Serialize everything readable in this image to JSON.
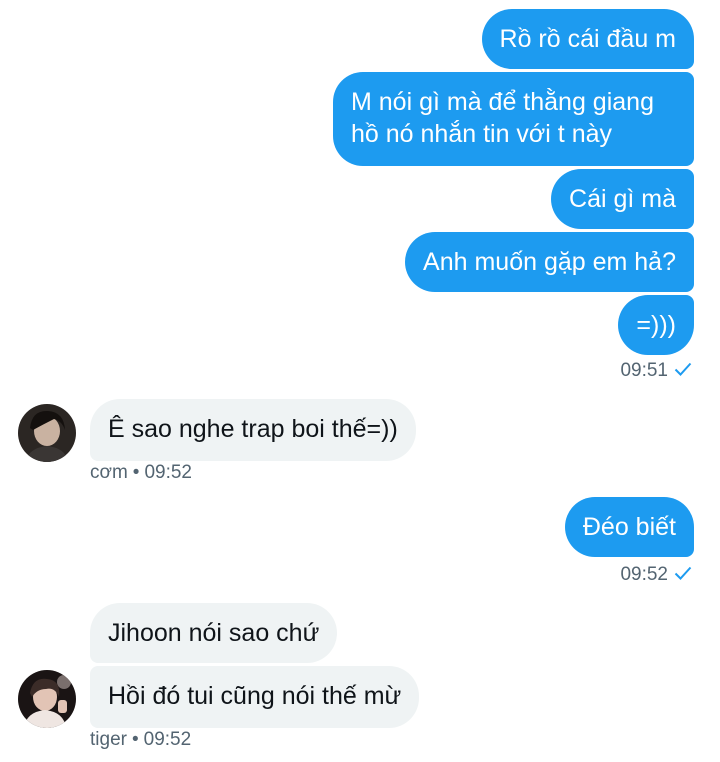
{
  "outgoing_color": "#1d9bf0",
  "incoming_color": "#eff3f4",
  "meta_color": "#536471",
  "messages": {
    "out1": "Rồ rồ cái đầu m",
    "out2_line1": "M nói gì mà để thằng giang",
    "out2_line2": "hồ nó nhắn tin với t này",
    "out3": "Cái gì mà",
    "out4": "Anh muốn gặp em hả?",
    "out5": "=)))",
    "in1": "Ê sao nghe trap boi thế=))",
    "out6": "Đéo biết",
    "in2": "Jihoon nói sao chứ",
    "in3": "Hồi đó tui cũng nói thế mừ"
  },
  "meta": {
    "time_sent_1": "09:51",
    "in1_sender": "cơm",
    "in1_time": "09:52",
    "time_sent_2": "09:52",
    "in3_sender": "tiger",
    "in3_time": "09:52",
    "separator": "•"
  },
  "icons": {
    "read_receipt": "check-icon",
    "avatar_1": "avatar-com",
    "avatar_2": "avatar-tiger"
  }
}
